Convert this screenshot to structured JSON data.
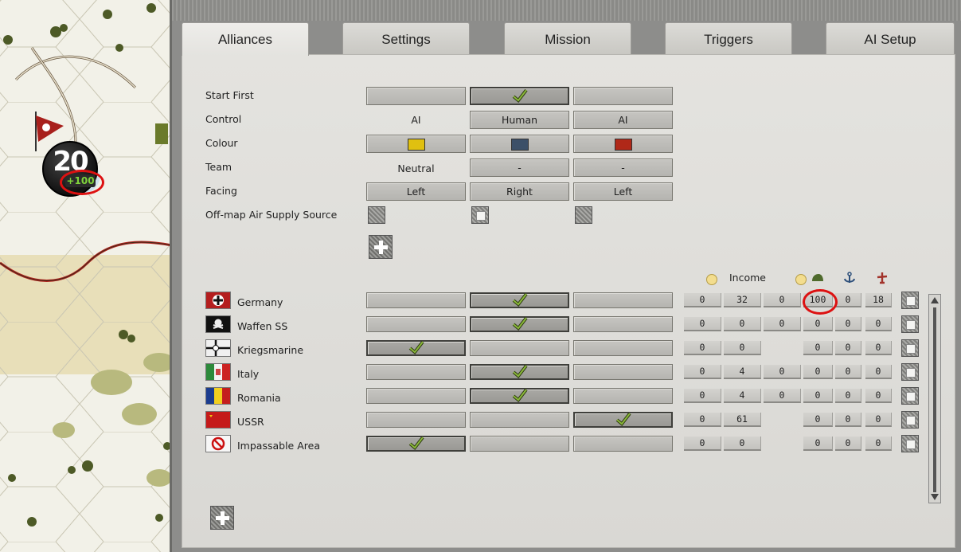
{
  "map": {
    "unit_strength": "20",
    "unit_bonus": "+100"
  },
  "tabs": [
    {
      "label": "Alliances",
      "active": true
    },
    {
      "label": "Settings",
      "active": false
    },
    {
      "label": "Mission",
      "active": false
    },
    {
      "label": "Triggers",
      "active": false
    },
    {
      "label": "AI Setup",
      "active": false
    }
  ],
  "sides": {
    "start_first": {
      "label": "Start First",
      "selected_column": 2
    },
    "control": {
      "label": "Control",
      "values": [
        "AI",
        "Human",
        "AI"
      ]
    },
    "colour": {
      "label": "Colour",
      "values": [
        "#e0c010",
        "#3c5068",
        "#b02818"
      ]
    },
    "team": {
      "label": "Team",
      "values": [
        "Neutral",
        "-",
        "-"
      ]
    },
    "facing": {
      "label": "Facing",
      "values": [
        "Left",
        "Right",
        "Left"
      ]
    },
    "air_supply": {
      "label": "Off-map Air Supply Source",
      "checked": [
        false,
        true,
        false
      ]
    }
  },
  "columns_header": {
    "income": "Income",
    "icons": [
      "coin-icon",
      "coin-icon",
      "helmet-icon",
      "anchor-icon",
      "plane-icon"
    ]
  },
  "factions": [
    {
      "name": "Germany",
      "side": 2,
      "values": [
        "0",
        "32",
        "0",
        "100",
        "0",
        "18"
      ]
    },
    {
      "name": "Waffen SS",
      "side": 2,
      "values": [
        "0",
        "0",
        "0",
        "0",
        "0",
        "0"
      ]
    },
    {
      "name": "Kriegsmarine",
      "side": 1,
      "values": [
        "0",
        "0",
        "",
        "0",
        "0",
        "0"
      ]
    },
    {
      "name": "Italy",
      "side": 2,
      "values": [
        "0",
        "4",
        "0",
        "0",
        "0",
        "0"
      ]
    },
    {
      "name": "Romania",
      "side": 2,
      "values": [
        "0",
        "4",
        "0",
        "0",
        "0",
        "0"
      ]
    },
    {
      "name": "USSR",
      "side": 3,
      "values": [
        "0",
        "61",
        "",
        "0",
        "0",
        "0"
      ]
    },
    {
      "name": "Impassable Area",
      "side": 1,
      "values": [
        "0",
        "0",
        "",
        "0",
        "0",
        "0"
      ]
    }
  ]
}
